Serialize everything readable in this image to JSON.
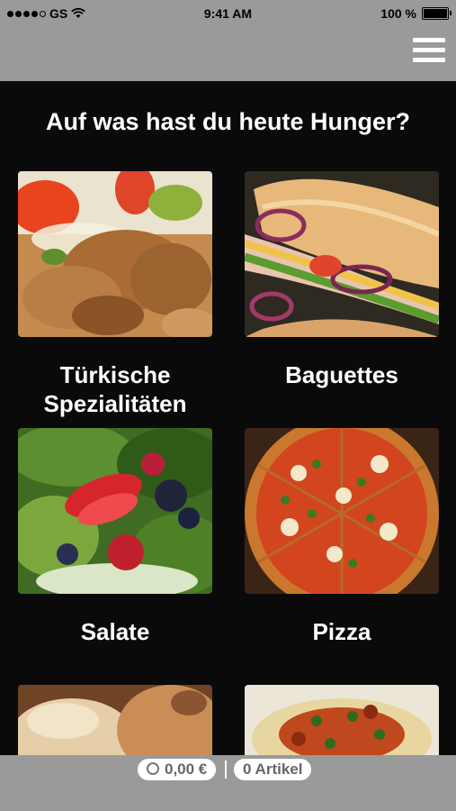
{
  "status_bar": {
    "carrier": "GS",
    "time": "9:41 AM",
    "battery": "100 %"
  },
  "headline": "Auf was hast du heute Hunger?",
  "categories": [
    {
      "label_line1": "Türkische",
      "label_line2": "Spezialitäten",
      "image": "doner-kebab-photo"
    },
    {
      "label_line1": "Baguettes",
      "label_line2": "",
      "image": "baguette-sandwich-photo"
    },
    {
      "label_line1": "Salate",
      "label_line2": "",
      "image": "salad-photo"
    },
    {
      "label_line1": "Pizza",
      "label_line2": "",
      "image": "pizza-photo"
    },
    {
      "label_line1": "",
      "label_line2": "",
      "image": "bread-rolls-photo"
    },
    {
      "label_line1": "",
      "label_line2": "",
      "image": "pasta-photo"
    }
  ],
  "footer": {
    "cart_total": "0,00 €",
    "item_count": "0 Artikel"
  },
  "colors": {
    "bars": "#9a9a9a",
    "background": "#0a0a0a",
    "text": "#ffffff"
  }
}
